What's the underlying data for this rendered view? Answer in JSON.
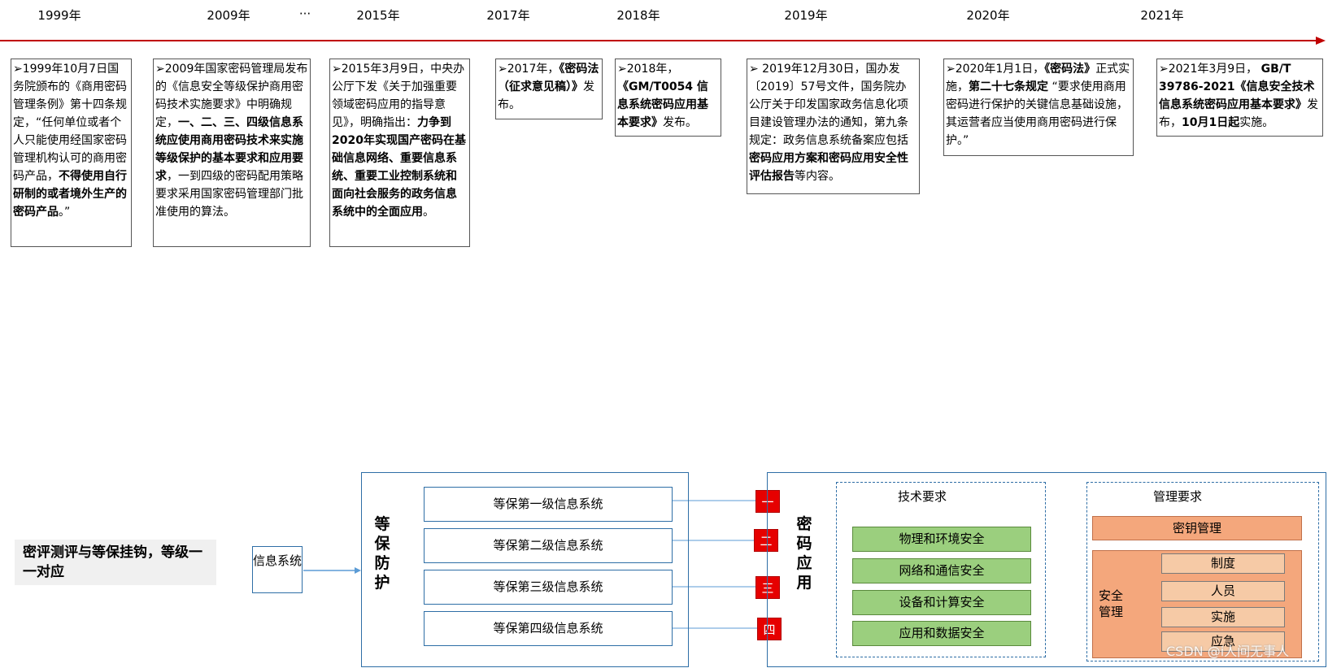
{
  "timeline": {
    "years": [
      "1999年",
      "2009年",
      "···",
      "2015年",
      "2017年",
      "2018年",
      "2019年",
      "2020年",
      "2021年"
    ],
    "cards": [
      {
        "runs": [
          {
            "t": "➢1999年10月7日国务院颁布的《商用密码管理条例》第十四条规定，“任何单位或者个人只能使用经国家密码管理机构认可的商用密码产品，",
            "b": false
          },
          {
            "t": "不得使用自行研制的或者境外生产的密码产品",
            "b": true
          },
          {
            "t": "。”",
            "b": false
          }
        ]
      },
      {
        "runs": [
          {
            "t": "➢2009年国家密码管理局发布的《信息安全等级保护商用密码技术实施要求》中明确规定，",
            "b": false
          },
          {
            "t": "一、二、三、四级信息系统应使用商用密码技术来实施等级保护的基本要求和应用要求",
            "b": true
          },
          {
            "t": "，一到四级的密码配用策略要求采用国家密码管理部门批准使用的算法。",
            "b": false
          }
        ]
      },
      {
        "runs": [
          {
            "t": "➢2015年3月9日，中央办公厅下发《关于加强重要领域密码应用的指导意见》，明确指出：",
            "b": false
          },
          {
            "t": "力争到2020年实现国产密码在基础信息网络、重要信息系统、重要工业控制系统和面向社会服务的政务信息系统中的全面应用",
            "b": true
          },
          {
            "t": "。",
            "b": false
          }
        ]
      },
      {
        "runs": [
          {
            "t": "➢2017年，",
            "b": false
          },
          {
            "t": "《密码法（征求意见稿）》",
            "b": true
          },
          {
            "t": "发布。",
            "b": false
          }
        ]
      },
      {
        "runs": [
          {
            "t": "➢2018年，",
            "b": false
          },
          {
            "t": "《GM/T0054 信息系统密码应用基本要求》",
            "b": true
          },
          {
            "t": "发布。",
            "b": false
          }
        ]
      },
      {
        "runs": [
          {
            "t": "➢ 2019年12月30日，国办发〔2019〕57号文件，国务院办公厅关于印发国家政务信息化项目建设管理办法的通知，第九条规定：政务信息系统备案应包括",
            "b": false
          },
          {
            "t": "密码应用方案和密码应用安全性评估报告",
            "b": true
          },
          {
            "t": "等内容。",
            "b": false
          }
        ]
      },
      {
        "runs": [
          {
            "t": "➢2020年1月1日，",
            "b": false
          },
          {
            "t": "《密码法》",
            "b": true
          },
          {
            "t": "正式实施，",
            "b": false
          },
          {
            "t": "第二十七条规定",
            "b": true
          },
          {
            "t": " “要求使用商用密码进行保护的关键信息基础设施，其运营者应当使用商用密码进行保护。”",
            "b": false
          }
        ]
      },
      {
        "runs": [
          {
            "t": "➢2021年3月9日， ",
            "b": false
          },
          {
            "t": "GB/T 39786-2021《信息安全技术 信息系统密码应用基本要求》",
            "b": true
          },
          {
            "t": "发布，",
            "b": false
          },
          {
            "t": "10月1日起",
            "b": true
          },
          {
            "t": "实施。",
            "b": false
          }
        ]
      }
    ]
  },
  "diagram": {
    "title": "密评测评与等保挂钩，等级一一对应",
    "info_system": "信息系统",
    "dengbao_label": "等保防护",
    "levels": [
      "等保第一级信息系统",
      "等保第二级信息系统",
      "等保第三级信息系统",
      "等保第四级信息系统"
    ],
    "level_tags": [
      "一",
      "二",
      "三",
      "四"
    ],
    "crypto_label": "密码应用",
    "tech": {
      "title": "技术要求",
      "items": [
        "物理和环境安全",
        "网络和通信安全",
        "设备和计算安全",
        "应用和数据安全"
      ]
    },
    "mgmt": {
      "title": "管理要求",
      "key_mgmt": "密钥管理",
      "security_label": "安全管理",
      "items": [
        "制度",
        "人员",
        "实施",
        "应急"
      ]
    }
  },
  "watermark": "CSDN @i人间无事人",
  "colors": {
    "timeline_line": "#c00000",
    "level_tag": "#e60000",
    "tech_item": "#9bcf7e",
    "mgmt_item": "#f6caa6",
    "frame": "#2e6ea6"
  }
}
